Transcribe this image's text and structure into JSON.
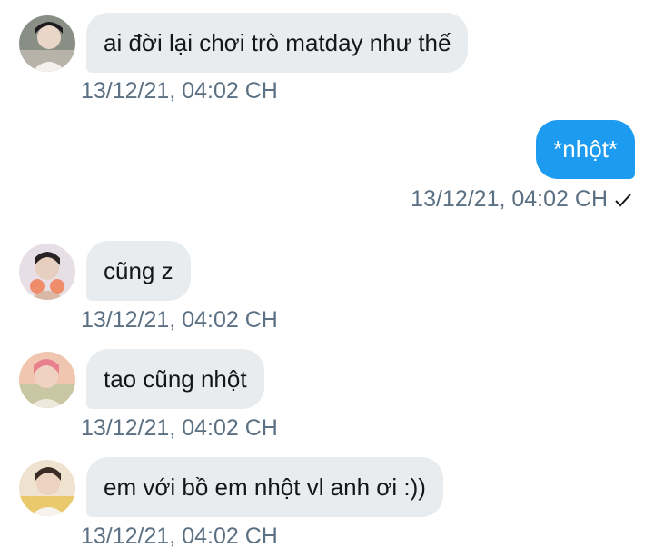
{
  "messages": [
    {
      "direction": "in",
      "avatar_icon": "avatar-icon",
      "text": "ai đời lại chơi trò matday như thế",
      "time": "13/12/21, 04:02 CH"
    },
    {
      "direction": "out",
      "text": "*nhột*",
      "time": "13/12/21, 04:02 CH",
      "status_icon": "checkmark-icon"
    },
    {
      "direction": "in",
      "avatar_icon": "avatar-icon",
      "text": "cũng z",
      "time": "13/12/21, 04:02 CH"
    },
    {
      "direction": "in",
      "avatar_icon": "avatar-icon",
      "text": "tao cũng nhột",
      "time": "13/12/21, 04:02 CH"
    },
    {
      "direction": "in",
      "avatar_icon": "avatar-icon",
      "text": "em với bồ em nhột vl anh ơi :))",
      "time": "13/12/21, 04:02 CH"
    }
  ],
  "colors": {
    "incoming_bubble": "#e9ecef",
    "outgoing_bubble": "#1d9bf0",
    "timestamp": "#5b7083",
    "text": "#14171a"
  }
}
